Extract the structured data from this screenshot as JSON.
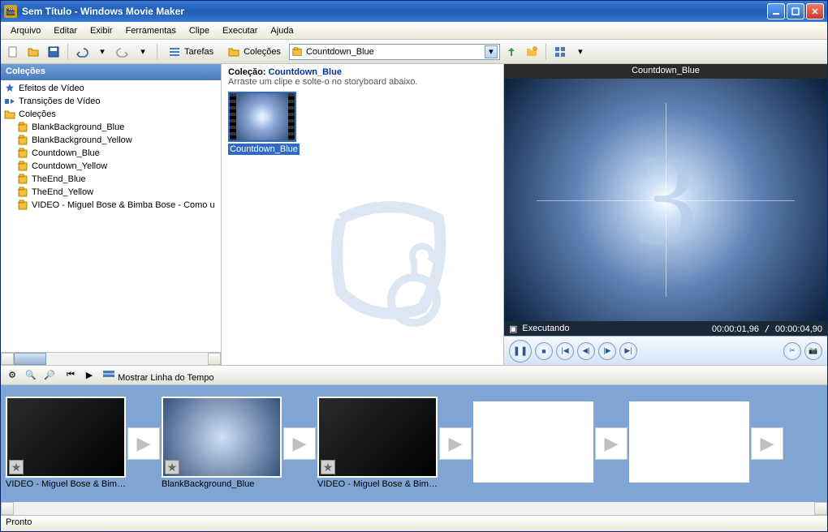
{
  "title": "Sem Título - Windows Movie Maker",
  "menus": [
    "Arquivo",
    "Editar",
    "Exibir",
    "Ferramentas",
    "Clipe",
    "Executar",
    "Ajuda"
  ],
  "toolbar": {
    "tasks_label": "Tarefas",
    "collections_label": "Coleções",
    "combo_value": "Countdown_Blue"
  },
  "sidebar": {
    "header": "Coleções",
    "items": [
      {
        "label": "Efeitos de Vídeo",
        "icon": "star",
        "indent": 0
      },
      {
        "label": "Transições de Vídeo",
        "icon": "transition",
        "indent": 0
      },
      {
        "label": "Coleções",
        "icon": "folder",
        "indent": 0
      },
      {
        "label": "BlankBackground_Blue",
        "icon": "collection",
        "indent": 1
      },
      {
        "label": "BlankBackground_Yellow",
        "icon": "collection",
        "indent": 1
      },
      {
        "label": "Countdown_Blue",
        "icon": "collection",
        "indent": 1,
        "selected": false
      },
      {
        "label": "Countdown_Yellow",
        "icon": "collection",
        "indent": 1
      },
      {
        "label": "TheEnd_Blue",
        "icon": "collection",
        "indent": 1
      },
      {
        "label": "TheEnd_Yellow",
        "icon": "collection",
        "indent": 1
      },
      {
        "label": "VIDEO - Miguel Bose & Bimba Bose - Como u",
        "icon": "collection",
        "indent": 1
      }
    ]
  },
  "collection": {
    "title_prefix": "Coleção: ",
    "title_name": "Countdown_Blue",
    "subtitle": "Arraste um clipe e solte-o no storyboard abaixo.",
    "clip_label": "Countdown_Blue"
  },
  "preview": {
    "title": "Countdown_Blue",
    "countdown_number": "3",
    "status": "Executando",
    "time_current": "00:00:01,96",
    "time_total": "00:00:04,90"
  },
  "timeline": {
    "toggle_label": "Mostrar Linha do Tempo",
    "clips": [
      {
        "caption": "VIDEO - Miguel Bose & Bimba ...",
        "style": "dark"
      },
      {
        "caption": "BlankBackground_Blue",
        "style": "blue"
      },
      {
        "caption": "VIDEO - Miguel Bose & Bimba ...",
        "style": "dark"
      },
      {
        "caption": "",
        "style": "empty"
      },
      {
        "caption": "",
        "style": "empty"
      }
    ]
  },
  "status": "Pronto"
}
